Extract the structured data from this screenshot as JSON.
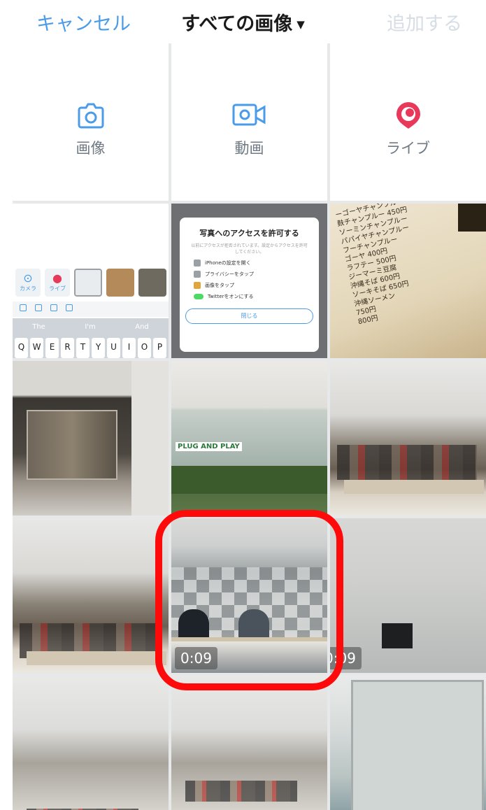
{
  "header": {
    "cancel": "キャンセル",
    "title": "すべての画像",
    "add": "追加する"
  },
  "options": [
    {
      "label": "画像",
      "icon": "camera-icon"
    },
    {
      "label": "動画",
      "icon": "video-camera-icon"
    },
    {
      "label": "ライブ",
      "icon": "live-periscope-icon"
    }
  ],
  "keyboard_thumb": {
    "mini_labels": [
      "カメラ",
      "ライブ"
    ],
    "suggestions": [
      "The",
      "I'm",
      "And"
    ],
    "keys": [
      "Q",
      "W",
      "E",
      "R",
      "T",
      "Y",
      "U",
      "I",
      "O",
      "P"
    ]
  },
  "permission_thumb": {
    "title": "写真へのアクセスを許可する",
    "description": "以前にアクセスが拒否されています。設定からアクセスを許可してください。",
    "steps": [
      "iPhoneの設定を開く",
      "プライバシーをタップ",
      "画像をタップ",
      "Twitterをオンにする"
    ],
    "close": "閉じる"
  },
  "menu_thumb": {
    "lines": [
      "ーゴーヤチャンプルー",
      "麩チャンプルー 450円",
      "ソーミンチャンプルー",
      "パパイヤチャンプルー",
      "フーチャンプルー",
      "ゴーヤ 400円",
      "ラフテー 500円",
      "ジーマーミ豆腐",
      "沖縄そば 600円",
      "ソーキそば 650円",
      "沖縄ソーメン",
      "750円",
      "800円"
    ]
  },
  "video_badges": {
    "selected": "0:09",
    "neighbor": "0:09"
  },
  "colors": {
    "accent": "#4a9be8",
    "add_disabled": "#d6dde4",
    "live": "#e8395a",
    "highlight": "#ff0a0a"
  }
}
